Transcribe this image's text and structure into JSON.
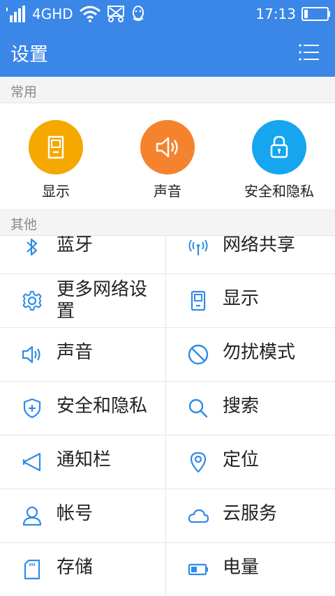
{
  "status_bar": {
    "network": "4GHD",
    "time": "17:13"
  },
  "app_bar": {
    "title": "设置"
  },
  "sections": {
    "common": "常用",
    "other": "其他"
  },
  "common_items": [
    {
      "label": "显示",
      "icon": "display-icon",
      "color": "#f4a800"
    },
    {
      "label": "声音",
      "icon": "speaker-icon",
      "color": "#f5832e"
    },
    {
      "label": "安全和隐私",
      "icon": "lock-icon",
      "color": "#16a5ef"
    }
  ],
  "grid_items": [
    {
      "label": "蓝牙",
      "icon": "bluetooth-icon"
    },
    {
      "label": "网络共享",
      "icon": "hotspot-icon"
    },
    {
      "label": "更多网络设置",
      "icon": "gear-icon"
    },
    {
      "label": "显示",
      "icon": "display-icon"
    },
    {
      "label": "声音",
      "icon": "speaker-icon"
    },
    {
      "label": "勿扰模式",
      "icon": "do-not-disturb-icon"
    },
    {
      "label": "安全和隐私",
      "icon": "shield-icon"
    },
    {
      "label": "搜索",
      "icon": "search-icon"
    },
    {
      "label": "通知栏",
      "icon": "notification-icon"
    },
    {
      "label": "定位",
      "icon": "location-icon"
    },
    {
      "label": "帐号",
      "icon": "account-icon"
    },
    {
      "label": "云服务",
      "icon": "cloud-icon"
    },
    {
      "label": "存储",
      "icon": "sd-card-icon"
    },
    {
      "label": "电量",
      "icon": "battery-icon"
    }
  ],
  "accent_color": "#3a87e8",
  "icon_color": "#2f8be6"
}
